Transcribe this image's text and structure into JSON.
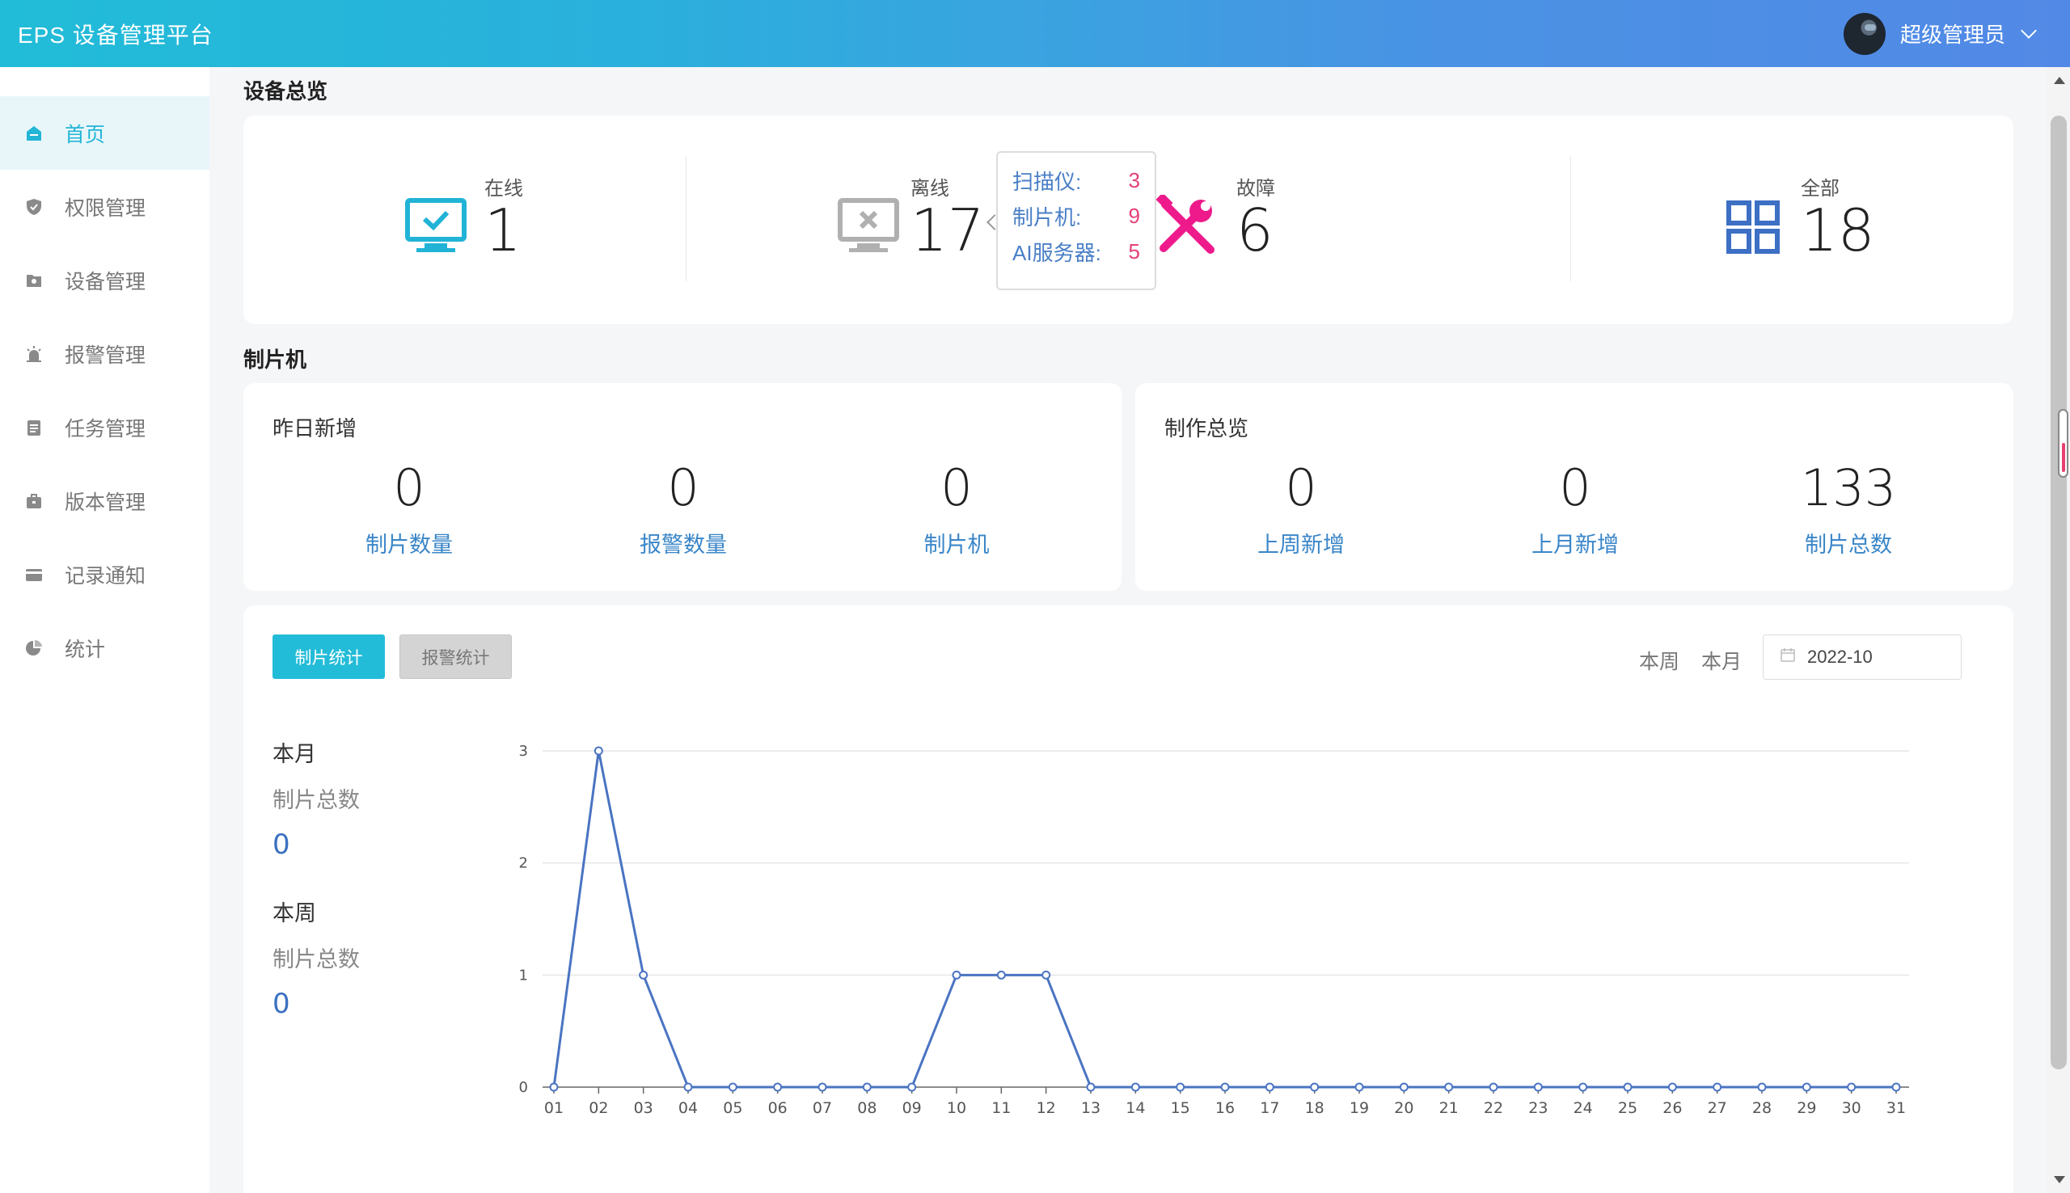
{
  "header": {
    "brand": "EPS 设备管理平台",
    "username": "超级管理员"
  },
  "sidebar": {
    "items": [
      {
        "label": "首页",
        "icon": "home-icon",
        "active": true
      },
      {
        "label": "权限管理",
        "icon": "shield-icon"
      },
      {
        "label": "设备管理",
        "icon": "device-icon"
      },
      {
        "label": "报警管理",
        "icon": "alarm-icon"
      },
      {
        "label": "任务管理",
        "icon": "clipboard-icon"
      },
      {
        "label": "版本管理",
        "icon": "briefcase-icon"
      },
      {
        "label": "记录通知",
        "icon": "card-icon"
      },
      {
        "label": "统计",
        "icon": "pie-icon"
      }
    ]
  },
  "overview": {
    "title": "设备总览",
    "online": {
      "label": "在线",
      "value": "1"
    },
    "offline": {
      "label": "离线",
      "value": "17"
    },
    "fault": {
      "label": "故障",
      "value": "6"
    },
    "all": {
      "label": "全部",
      "value": "18"
    },
    "tooltip": [
      {
        "k": "扫描仪:",
        "v": "3"
      },
      {
        "k": "制片机:",
        "v": "9"
      },
      {
        "k": "AI服务器:",
        "v": "5"
      }
    ]
  },
  "maker": {
    "title": "制片机",
    "yesterday": {
      "title": "昨日新增",
      "items": [
        {
          "num": "0",
          "label": "制片数量"
        },
        {
          "num": "0",
          "label": "报警数量"
        },
        {
          "num": "0",
          "label": "制片机"
        }
      ]
    },
    "production": {
      "title": "制作总览",
      "items": [
        {
          "num": "0",
          "label": "上周新增"
        },
        {
          "num": "0",
          "label": "上月新增"
        },
        {
          "num": "133",
          "label": "制片总数"
        }
      ]
    }
  },
  "stats": {
    "tab_primary": "制片统计",
    "tab_secondary": "报警统计",
    "period_week": "本周",
    "period_month": "本月",
    "date_value": "2022-10",
    "month_block": {
      "head": "本月",
      "sub": "制片总数",
      "value": "0"
    },
    "week_block": {
      "head": "本周",
      "sub": "制片总数",
      "value": "0"
    }
  },
  "colors": {
    "accent": "#23bcd8",
    "line": "#4a74c2",
    "fault": "#ee1a8c",
    "all_icon": "#3d6fc4"
  },
  "chart_data": {
    "type": "line",
    "categories": [
      "01",
      "02",
      "03",
      "04",
      "05",
      "06",
      "07",
      "08",
      "09",
      "10",
      "11",
      "12",
      "13",
      "14",
      "15",
      "16",
      "17",
      "18",
      "19",
      "20",
      "21",
      "22",
      "23",
      "24",
      "25",
      "26",
      "27",
      "28",
      "29",
      "30",
      "31"
    ],
    "values": [
      0,
      3,
      1,
      0,
      0,
      0,
      0,
      0,
      0,
      1,
      1,
      1,
      0,
      0,
      0,
      0,
      0,
      0,
      0,
      0,
      0,
      0,
      0,
      0,
      0,
      0,
      0,
      0,
      0,
      0,
      0
    ],
    "ylim": [
      0,
      3
    ],
    "yticks": [
      0,
      1,
      2,
      3
    ],
    "grid": true
  }
}
